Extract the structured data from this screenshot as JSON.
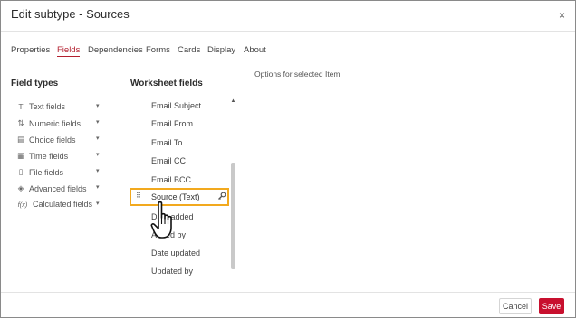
{
  "dialog": {
    "title": "Edit subtype - Sources",
    "close_glyph": "×"
  },
  "tabs": [
    {
      "label": "Properties",
      "active": false
    },
    {
      "label": "Fields",
      "active": true
    },
    {
      "label": "Dependencies",
      "active": false
    },
    {
      "label": "Forms",
      "active": false
    },
    {
      "label": "Cards",
      "active": false
    },
    {
      "label": "Display",
      "active": false
    },
    {
      "label": "About",
      "active": false
    }
  ],
  "field_types": {
    "heading": "Field types",
    "items": [
      {
        "label": "Text fields",
        "icon": "text-type-icon",
        "glyph": "T"
      },
      {
        "label": "Numeric fields",
        "icon": "numeric-type-icon",
        "glyph": "⇅"
      },
      {
        "label": "Choice fields",
        "icon": "choice-type-icon",
        "glyph": "▤"
      },
      {
        "label": "Time fields",
        "icon": "calendar-icon",
        "glyph": "▦"
      },
      {
        "label": "File fields",
        "icon": "file-icon",
        "glyph": "▯"
      },
      {
        "label": "Advanced fields",
        "icon": "cube-icon",
        "glyph": "◈"
      },
      {
        "label": "Calculated fields",
        "icon": "function-icon",
        "glyph": "f(x)"
      }
    ],
    "chevron": "▾"
  },
  "worksheet_fields": {
    "heading": "Worksheet fields",
    "items": [
      "Email Subject",
      "Email From",
      "Email To",
      "Email CC",
      "Email BCC",
      "Source (Text)",
      "Date added",
      "Added by",
      "Date updated",
      "Updated by"
    ],
    "selected_index": 5,
    "selected_label": "Source (Text)",
    "drag_glyph": "⠿",
    "key_glyph": "🔑"
  },
  "options_panel": {
    "label": "Options for selected Item"
  },
  "footer": {
    "cancel_label": "Cancel",
    "save_label": "Save"
  },
  "colors": {
    "accent": "#b3202f",
    "save_button": "#c8102e",
    "highlight_border": "#f2a91e"
  }
}
